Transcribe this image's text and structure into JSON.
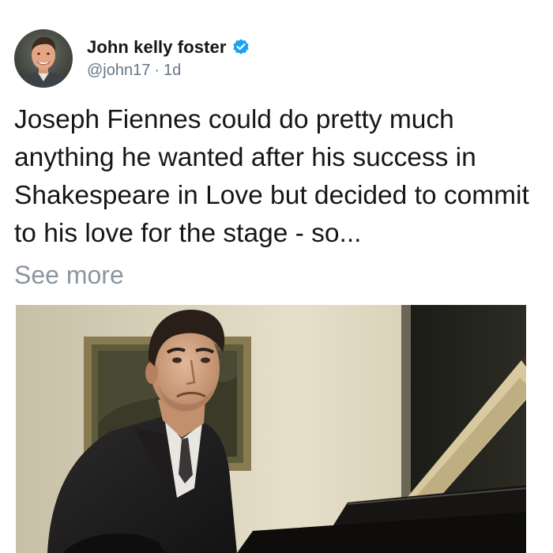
{
  "tweet": {
    "author": {
      "display_name": "John kelly foster",
      "handle": "@john17",
      "separator": "·",
      "time": "1d",
      "avatar_icon": "avatar-photo",
      "verified_icon": "verified-badge-icon"
    },
    "text": "Joseph Fiennes could do pretty much anything he wanted after his success in Shakespeare in Love but decided to commit to his love for the stage - so...",
    "see_more": "See more",
    "media": {
      "icon": "photo-man-at-piano"
    }
  },
  "colors": {
    "verified": "#1da1f2",
    "text": "#14171a",
    "muted": "#657786",
    "see_more": "#8b96a0"
  }
}
